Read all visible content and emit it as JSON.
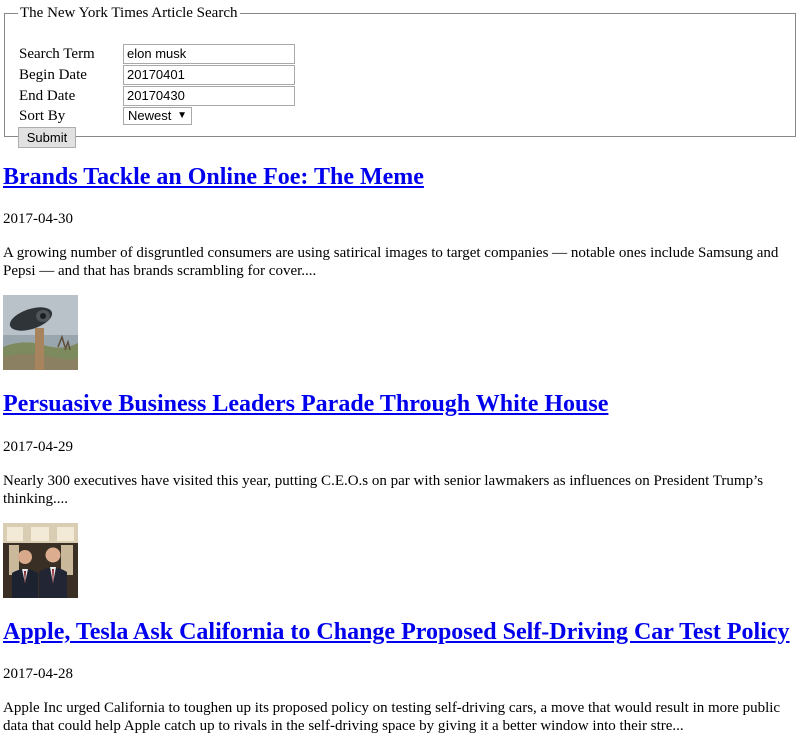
{
  "search_form": {
    "legend": "The New York Times Article Search",
    "search_term_label": "Search Term",
    "search_term_value": "elon musk",
    "begin_date_label": "Begin Date",
    "begin_date_value": "20170401",
    "end_date_label": "End Date",
    "end_date_value": "20170430",
    "sort_by_label": "Sort By",
    "sort_by_value": "Newest",
    "submit_label": "Submit"
  },
  "articles": [
    {
      "title": "Brands Tackle an Online Foe: The Meme",
      "date": "2017-04-30",
      "snippet": "A growing number of disgruntled consumers are using satirical images to target companies — notable ones include Samsung and Pepsi — and that has brands scrambling for cover....",
      "thumbnail": "ostrich-vr-headset-image"
    },
    {
      "title": "Persuasive Business Leaders Parade Through White House",
      "date": "2017-04-29",
      "snippet": "Nearly 300 executives have visited this year, putting C.E.O.s on par with senior lawmakers as influences on President Trump’s thinking....",
      "thumbnail": "two-executives-photo"
    },
    {
      "title": "Apple, Tesla Ask California to Change Proposed Self-Driving Car Test Policy",
      "date": "2017-04-28",
      "snippet": "Apple Inc urged California to toughen up its proposed policy on testing self-driving cars, a move that would result in more public data that could help Apple catch up to rivals in the self-driving space by giving it a better window into their stre..."
    }
  ]
}
